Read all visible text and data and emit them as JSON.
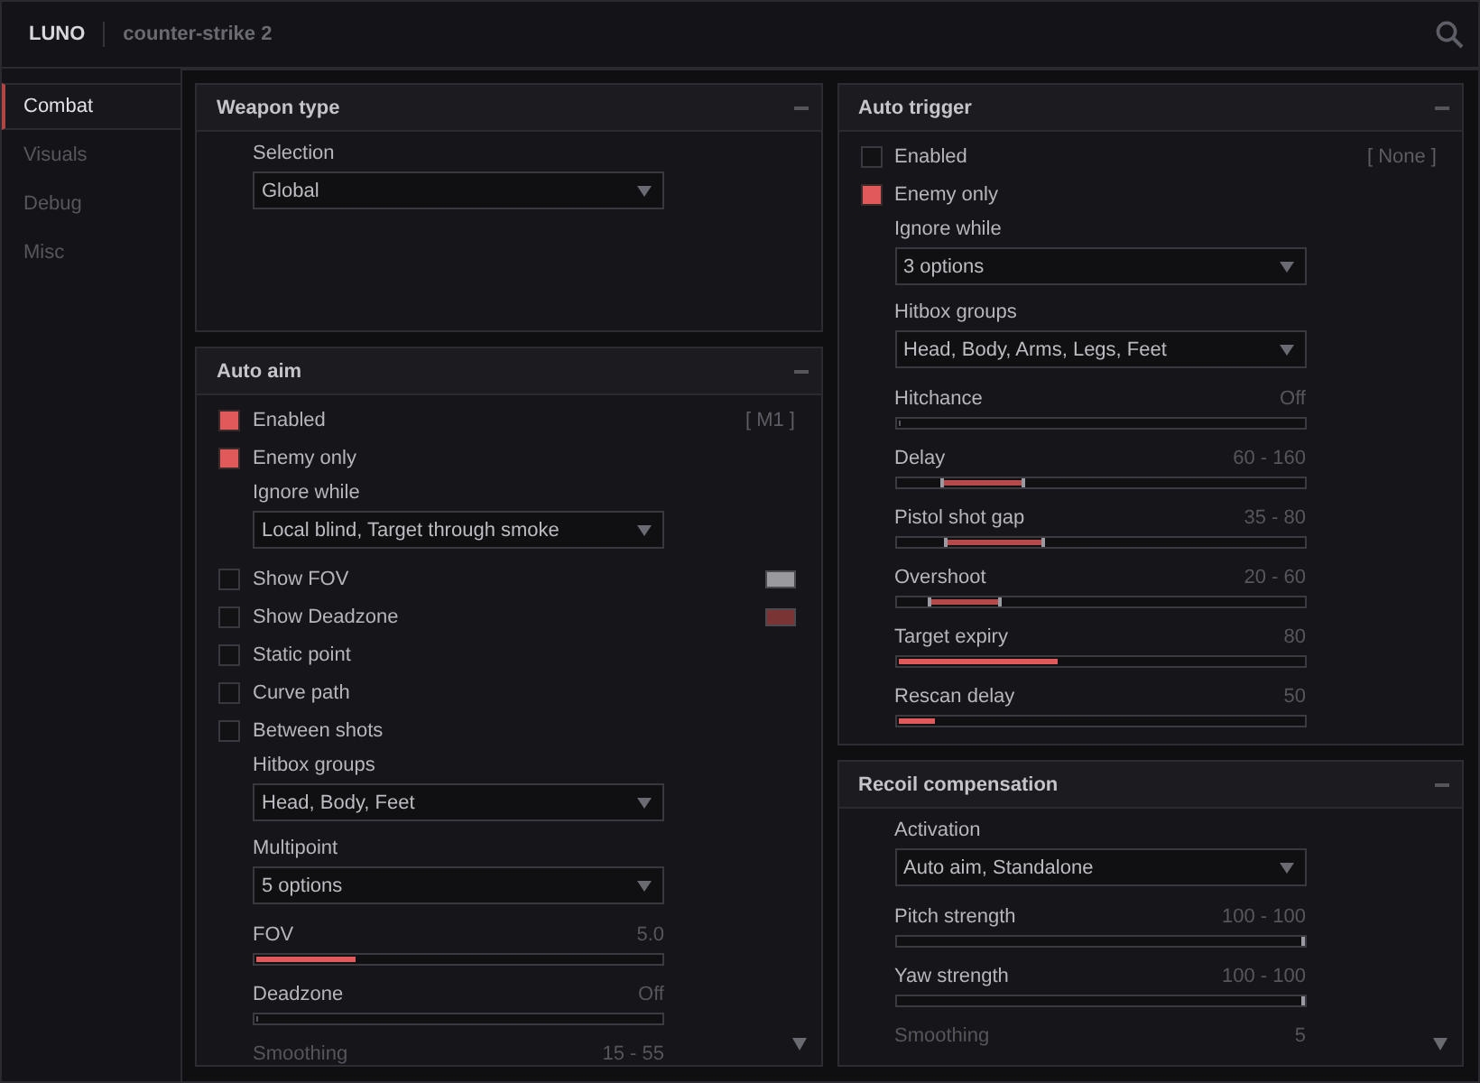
{
  "header": {
    "brand": "LUNO",
    "game": "counter-strike 2"
  },
  "sidebar": {
    "items": [
      {
        "label": "Combat",
        "selected": true
      },
      {
        "label": "Visuals",
        "selected": false
      },
      {
        "label": "Debug",
        "selected": false
      },
      {
        "label": "Misc",
        "selected": false
      }
    ]
  },
  "columns": [
    {
      "panels": [
        {
          "title": "Weapon type",
          "more_below": false,
          "rows": [
            {
              "kind": "dropdown",
              "label": "Selection",
              "value": "Global"
            }
          ]
        },
        {
          "title": "Auto aim",
          "more_below": true,
          "rows": [
            {
              "kind": "checkbox",
              "label": "Enabled",
              "checked": true,
              "keybind": "[ M1 ]"
            },
            {
              "kind": "checkbox",
              "label": "Enemy only",
              "checked": true
            },
            {
              "kind": "dropdown",
              "label": "Ignore while",
              "value": "Local blind, Target through smoke"
            },
            {
              "kind": "checkbox",
              "label": "Show FOV",
              "checked": false,
              "color": "#9a9a9e"
            },
            {
              "kind": "checkbox",
              "label": "Show Deadzone",
              "checked": false,
              "color": "#7a3434"
            },
            {
              "kind": "checkbox",
              "label": "Static point",
              "checked": false
            },
            {
              "kind": "checkbox",
              "label": "Curve path",
              "checked": false
            },
            {
              "kind": "checkbox",
              "label": "Between shots",
              "checked": false
            },
            {
              "kind": "dropdown",
              "label": "Hitbox groups",
              "value": "Head, Body, Feet"
            },
            {
              "kind": "dropdown",
              "label": "Multipoint",
              "value": "5 options"
            },
            {
              "kind": "slider",
              "label": "FOV",
              "reading": "5.0",
              "level": 0.25
            },
            {
              "kind": "slider",
              "label": "Deadzone",
              "reading": "Off",
              "level": 0
            },
            {
              "kind": "slider",
              "label": "Smoothing",
              "reading": "15 - 55"
            }
          ]
        }
      ]
    },
    {
      "panels": [
        {
          "title": "Auto trigger",
          "more_below": false,
          "rows": [
            {
              "kind": "checkbox",
              "label": "Enabled",
              "checked": false,
              "keybind": "[ None ]"
            },
            {
              "kind": "checkbox",
              "label": "Enemy only",
              "checked": true
            },
            {
              "kind": "dropdown",
              "label": "Ignore while",
              "value": "3 options"
            },
            {
              "kind": "dropdown",
              "label": "Hitbox groups",
              "value": "Head, Body, Arms, Legs, Feet"
            },
            {
              "kind": "slider",
              "label": "Hitchance",
              "reading": "Off",
              "level": 0
            },
            {
              "kind": "slider",
              "label": "Delay",
              "reading": "60 - 160",
              "handles": [
                {
                  "level": 0.11
                },
                {
                  "level": 0.31
                }
              ]
            },
            {
              "kind": "slider",
              "label": "Pistol shot gap",
              "reading": "35 - 80",
              "handles": [
                {
                  "level": 0.12
                },
                {
                  "level": 0.36
                }
              ]
            },
            {
              "kind": "slider",
              "label": "Overshoot",
              "reading": "20 - 60",
              "handles": [
                {
                  "level": 0.08
                },
                {
                  "level": 0.25
                }
              ]
            },
            {
              "kind": "slider",
              "label": "Target expiry",
              "reading": "80",
              "level": 0.4
            },
            {
              "kind": "slider",
              "label": "Rescan delay",
              "reading": "50",
              "level": 0.1
            }
          ]
        },
        {
          "title": "Recoil compensation",
          "more_below": true,
          "rows": [
            {
              "kind": "dropdown",
              "label": "Activation",
              "value": "Auto aim, Standalone"
            },
            {
              "kind": "slider",
              "label": "Pitch strength",
              "reading": "100 - 100",
              "handles": [
                {
                  "level": 1
                },
                {
                  "level": 1
                }
              ]
            },
            {
              "kind": "slider",
              "label": "Yaw strength",
              "reading": "100 - 100",
              "handles": [
                {
                  "level": 1
                },
                {
                  "level": 1
                }
              ]
            },
            {
              "kind": "slider",
              "label": "Smoothing",
              "reading": "5"
            }
          ]
        }
      ]
    }
  ]
}
